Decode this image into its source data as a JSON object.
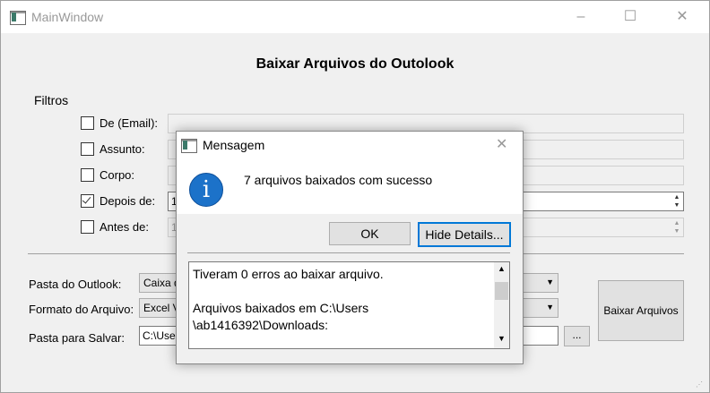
{
  "window": {
    "title": "MainWindow",
    "minimize": "–",
    "maximize": "☐",
    "close": "✕"
  },
  "heading": "Baixar Arquivos do Outolook",
  "filters": {
    "label": "Filtros",
    "rows": [
      {
        "label": "De (Email):",
        "checked": false,
        "value": ""
      },
      {
        "label": "Assunto:",
        "checked": false,
        "value": ""
      },
      {
        "label": "Corpo:",
        "checked": false,
        "value": ""
      },
      {
        "label": "Depois de:",
        "checked": true,
        "value": "1"
      },
      {
        "label": "Antes de:",
        "checked": false,
        "value": "1"
      }
    ]
  },
  "options": {
    "folder_label": "Pasta do Outlook:",
    "folder_value": "Caixa d",
    "format_label": "Formato do Arquivo:",
    "format_value": "Excel V",
    "save_label": "Pasta para Salvar:",
    "save_value": "C:\\Use",
    "browse_label": "...",
    "download_label": "Baixar Arquivos"
  },
  "dialog": {
    "title": "Mensagem",
    "close": "✕",
    "message": "7 arquivos baixados com sucesso",
    "ok_label": "OK",
    "details_label": "Hide Details...",
    "details_text": "Tiveram 0 erros ao baixar arquivo.\n\nArquivos baixados em C:\\Users\n\\ab1416392\\Downloads:"
  }
}
